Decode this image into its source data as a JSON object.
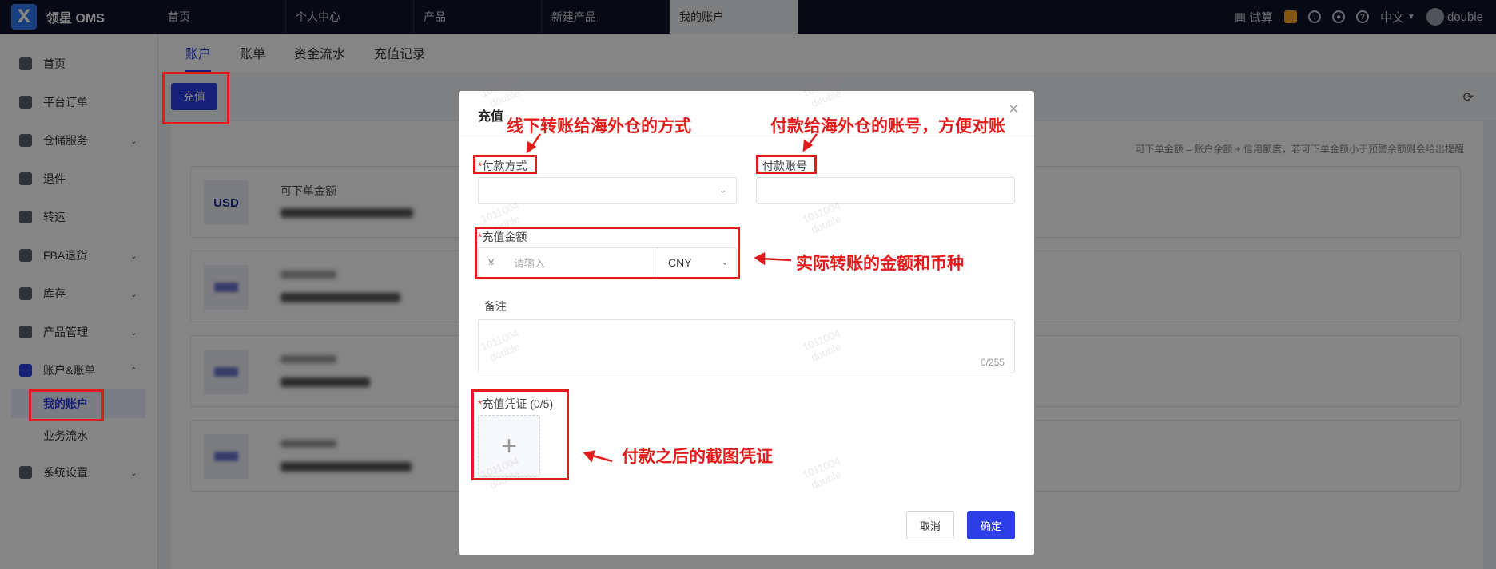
{
  "app": {
    "logo_glyph": "X",
    "name": "领星 OMS"
  },
  "nav_tabs": [
    "首页",
    "个人中心",
    "产品",
    "新建产品",
    "我的账户"
  ],
  "topbar": {
    "calc": "试算",
    "language": "中文",
    "user": "double"
  },
  "sidebar": {
    "items": [
      {
        "label": "首页",
        "icon": "home-icon"
      },
      {
        "label": "平台订单",
        "icon": "order-icon"
      },
      {
        "label": "仓储服务",
        "icon": "warehouse-icon"
      },
      {
        "label": "退件",
        "icon": "return-icon"
      },
      {
        "label": "转运",
        "icon": "transfer-icon"
      },
      {
        "label": "FBA退货",
        "icon": "fba-icon"
      },
      {
        "label": "库存",
        "icon": "inventory-icon"
      },
      {
        "label": "产品管理",
        "icon": "product-icon"
      },
      {
        "label": "账户&账单",
        "icon": "account-icon"
      },
      {
        "label": "系统设置",
        "icon": "settings-icon"
      }
    ],
    "sub_items": [
      "我的账户",
      "业务流水"
    ]
  },
  "subtabs": [
    "账户",
    "账单",
    "资金流水",
    "充值记录"
  ],
  "toolbar": {
    "recharge_label": "充值"
  },
  "page_note": "可下单金额 = 账户余额 + 信用额度，若可下单金额小于预警余额则会给出提醒",
  "cards": [
    {
      "currency": "USD",
      "label": "可下单金额"
    }
  ],
  "modal": {
    "title": "充值",
    "close": "×",
    "payment_method_label": "付款方式",
    "payment_account_label": "付款账号",
    "amount_label": "充值金额",
    "amount_prefix": "¥",
    "amount_placeholder": "请输入",
    "currency_value": "CNY",
    "remark_label": "备注",
    "remark_counter": "0/255",
    "voucher_label": "充值凭证 (0/5)",
    "upload_plus": "+",
    "cancel_label": "取消",
    "confirm_label": "确定"
  },
  "watermark": {
    "line1": "1011004",
    "line2": "double"
  },
  "annotations": {
    "payment_method": "线下转账给海外仓的方式",
    "payment_account": "付款给海外仓的账号，方便对账",
    "amount": "实际转账的金额和币种",
    "voucher": "付款之后的截图凭证",
    "color": "#e21c1c"
  }
}
